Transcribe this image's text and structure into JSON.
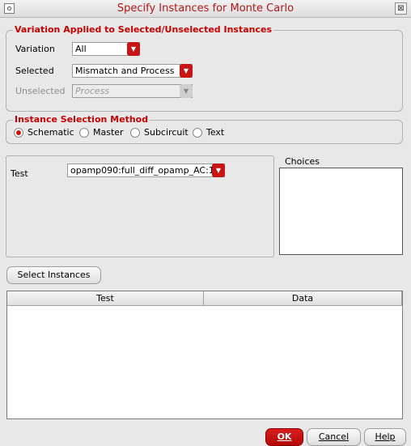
{
  "window": {
    "title": "Specify Instances for Monte Carlo",
    "close_glyph": "⊠"
  },
  "variation_group": {
    "title": "Variation Applied to Selected/Unselected Instances",
    "variation_label": "Variation",
    "variation_value": "All",
    "selected_label": "Selected",
    "selected_value": "Mismatch and Process",
    "unselected_label": "Unselected",
    "unselected_value": "Process"
  },
  "method_group": {
    "title": "Instance Selection Method",
    "options": [
      "Schematic",
      "Master",
      "Subcircuit",
      "Text"
    ],
    "selected": "Schematic"
  },
  "test_panel": {
    "test_label": "Test",
    "test_value": "opamp090:full_diff_opamp_AC:1"
  },
  "choices": {
    "label": "Choices"
  },
  "select_instances_button": "Select Instances",
  "table": {
    "columns": [
      "Test",
      "Data"
    ],
    "rows": []
  },
  "footer": {
    "ok": "OK",
    "cancel": "Cancel",
    "help": "Help"
  },
  "colors": {
    "accent": "#c81414",
    "group_title": "#c80000"
  }
}
